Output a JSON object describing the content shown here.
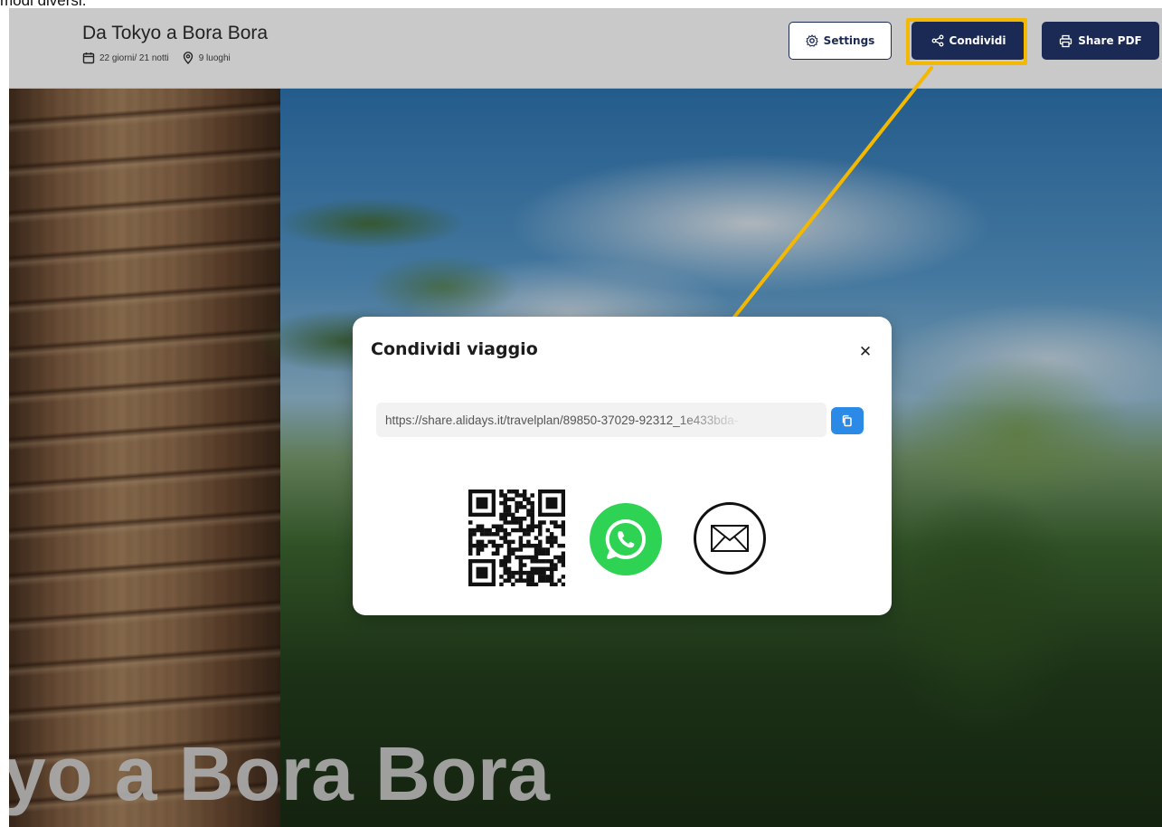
{
  "document": {
    "caption": "modi diversi."
  },
  "header": {
    "trip_title": "Da Tokyo a Bora Bora",
    "duration": "22 giorni/ 21 notti",
    "places": "9 luoghi",
    "buttons": {
      "settings": "Settings",
      "share": "Condividi",
      "share_pdf": "Share PDF"
    },
    "highlight_color": "#f5b800",
    "accent_color": "#1b2a55"
  },
  "background": {
    "title": "yo a Bora Bora"
  },
  "modal": {
    "title": "Condividi viaggio",
    "close_icon": "close-icon",
    "share_url": "https://share.alidays.it/travelplan/89850-37029-92312_1e433bda-",
    "copy_icon": "copy-icon",
    "share_options": [
      "qr-code",
      "whatsapp-icon",
      "email-icon"
    ],
    "copy_button_color": "#2b8ae6",
    "whatsapp_color": "#2fd354"
  }
}
